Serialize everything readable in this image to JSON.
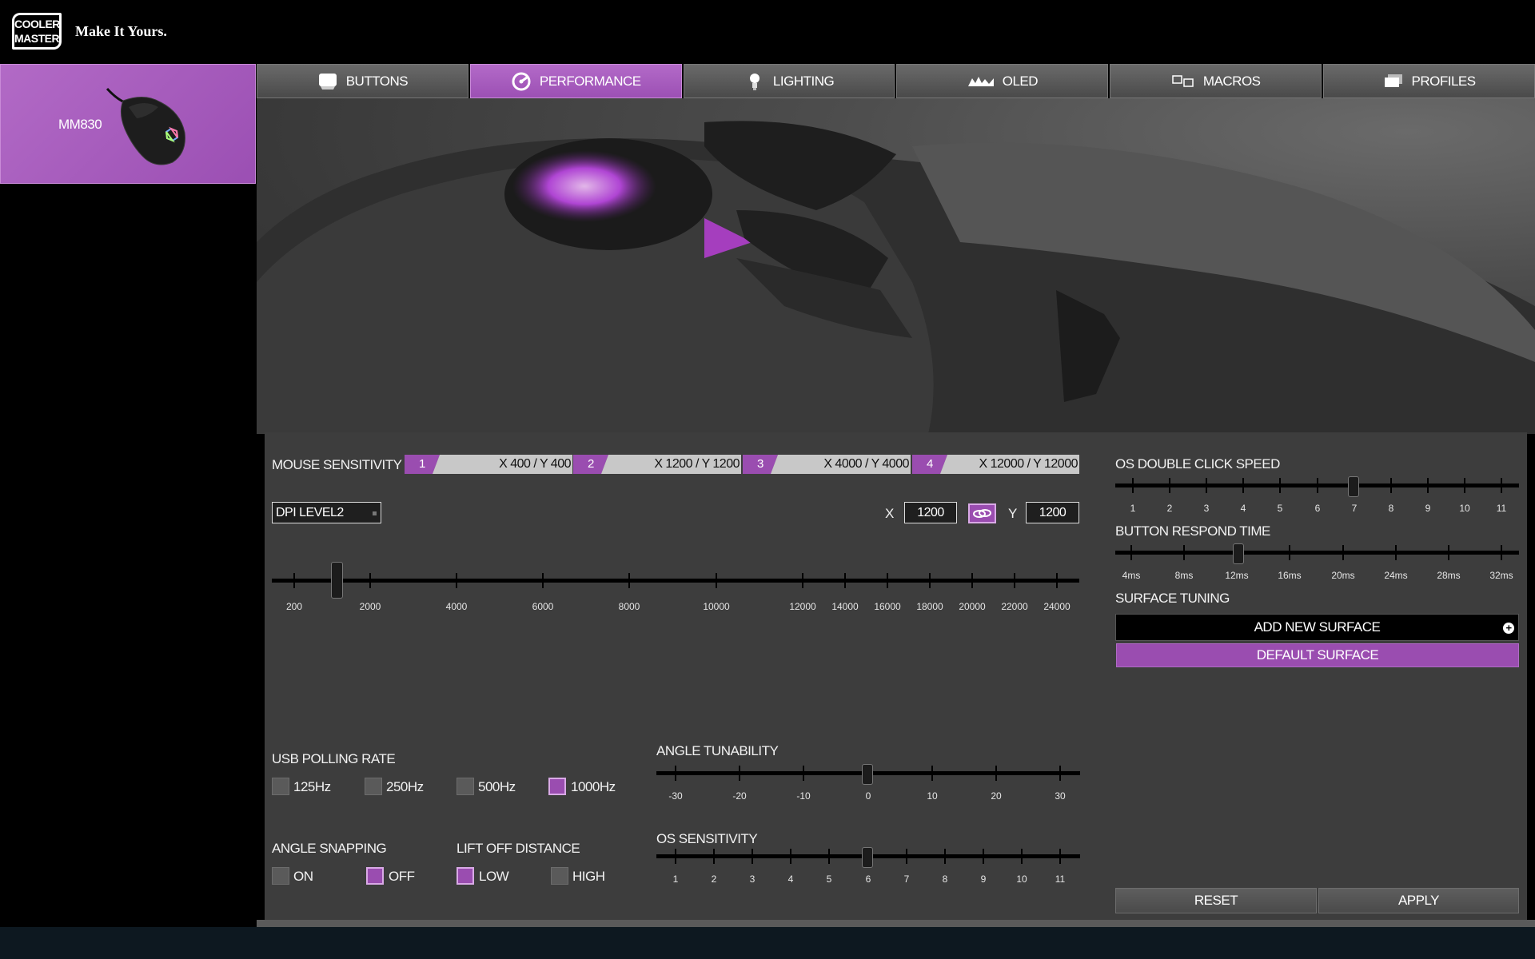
{
  "header": {
    "logo_line1": "COOLER",
    "logo_line2": "MASTER",
    "tagline": "Make It Yours."
  },
  "sidebar": {
    "device_name": "MM830"
  },
  "tabs": [
    {
      "label": "BUTTONS",
      "icon": "keycap-icon"
    },
    {
      "label": "PERFORMANCE",
      "icon": "gauge-icon"
    },
    {
      "label": "LIGHTING",
      "icon": "bulb-icon"
    },
    {
      "label": "OLED",
      "icon": "oled-display-icon"
    },
    {
      "label": "MACROS",
      "icon": "macro-keys-icon"
    },
    {
      "label": "PROFILES",
      "icon": "profiles-icon"
    }
  ],
  "active_tab": "PERFORMANCE",
  "sensitivity": {
    "label": "MOUSE SENSITIVITY",
    "stages": [
      {
        "num": "1",
        "value": "X 400 / Y 400"
      },
      {
        "num": "2",
        "value": "X 1200 / Y 1200"
      },
      {
        "num": "3",
        "value": "X 4000 / Y 4000"
      },
      {
        "num": "4",
        "value": "X 12000 / Y 12000"
      }
    ],
    "dpi_level": "DPI LEVEL2",
    "x_label": "X",
    "x_value": "1200",
    "y_label": "Y",
    "y_value": "1200",
    "slider_ticks": [
      "200",
      "2000",
      "4000",
      "6000",
      "8000",
      "10000",
      "12000",
      "14000",
      "16000",
      "18000",
      "20000",
      "22000",
      "24000"
    ],
    "slider_value": 1200
  },
  "polling": {
    "label": "USB POLLING RATE",
    "options": [
      {
        "label": "125Hz",
        "checked": false
      },
      {
        "label": "250Hz",
        "checked": false
      },
      {
        "label": "500Hz",
        "checked": false
      },
      {
        "label": "1000Hz",
        "checked": true
      }
    ]
  },
  "angle_snapping": {
    "label": "ANGLE SNAPPING",
    "on": "ON",
    "off": "OFF",
    "value": "OFF"
  },
  "lift_off": {
    "label": "LIFT OFF DISTANCE",
    "low": "LOW",
    "high": "HIGH",
    "value": "LOW"
  },
  "angle_tunability": {
    "label": "ANGLE TUNABILITY",
    "ticks": [
      "-30",
      "-20",
      "-10",
      "0",
      "10",
      "20",
      "30"
    ],
    "value": "0"
  },
  "os_sensitivity": {
    "label": "OS SENSITIVITY",
    "ticks": [
      "1",
      "2",
      "3",
      "4",
      "5",
      "6",
      "7",
      "8",
      "9",
      "10",
      "11"
    ],
    "value": "6"
  },
  "double_click": {
    "label": "OS DOUBLE CLICK SPEED",
    "ticks": [
      "1",
      "2",
      "3",
      "4",
      "5",
      "6",
      "7",
      "8",
      "9",
      "10",
      "11"
    ],
    "value": "7"
  },
  "respond_time": {
    "label": "BUTTON RESPOND TIME",
    "ticks": [
      "4ms",
      "8ms",
      "12ms",
      "16ms",
      "20ms",
      "24ms",
      "28ms",
      "32ms"
    ],
    "value": "12ms"
  },
  "surface": {
    "label": "SURFACE TUNING",
    "add": "ADD NEW SURFACE",
    "default": "DEFAULT SURFACE"
  },
  "actions": {
    "reset": "RESET",
    "apply": "APPLY"
  },
  "colors": {
    "accent": "#9a4db0",
    "panel": "#3d3d3d"
  }
}
